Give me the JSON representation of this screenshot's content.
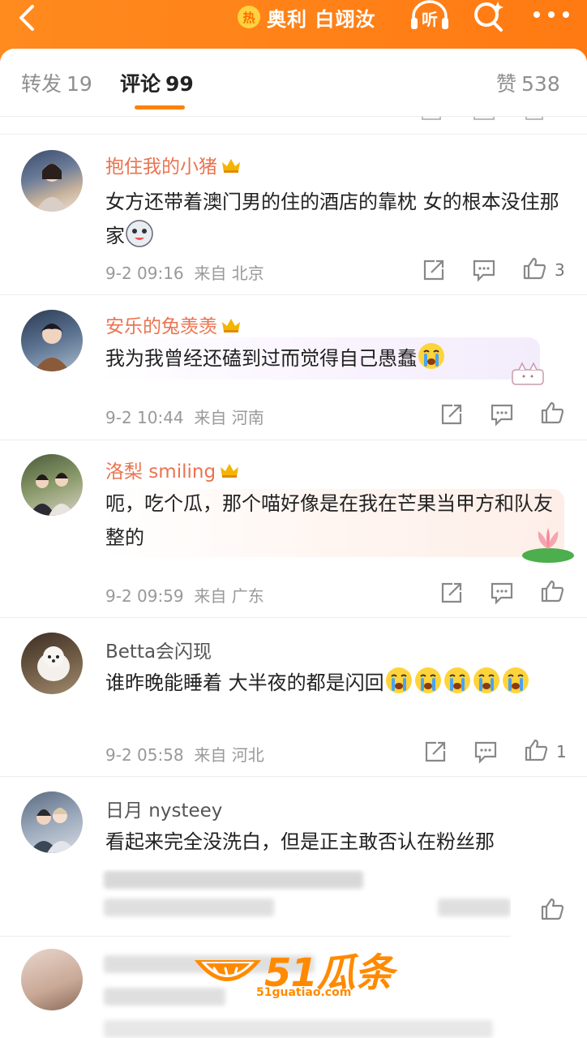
{
  "header": {
    "title": "奥利 白翊汝",
    "hot_badge": "热",
    "listen_label": "听",
    "back_icon": "chevron-left-icon",
    "search_icon": "search-sparkle-icon",
    "more_icon": "ellipsis-icon",
    "accent_color": "#ff8200"
  },
  "tabs": [
    {
      "label": "转发",
      "count": "19"
    },
    {
      "label": "评论",
      "count": "99",
      "active": true
    },
    {
      "label": "赞",
      "count": "538"
    }
  ],
  "comments": [
    {
      "username": "抱住我的小猪",
      "vip": true,
      "text": "女方还带着澳门男的住的酒店的靠枕 女的根本没住那家",
      "time": "9-2 09:16",
      "location": "来自 北京",
      "likes": "3"
    },
    {
      "username": "安乐的兔羡羡",
      "vip": true,
      "text": "我为我曾经还磕到过而觉得自己愚蠢",
      "time": "9-2 10:44",
      "location": "来自 河南",
      "likes": ""
    },
    {
      "username": "洛梨 smiling",
      "vip": true,
      "text": "呃，吃个瓜，那个喵好像是在我在芒果当甲方和队友整的",
      "time": "9-2 09:59",
      "location": "来自 广东",
      "likes": ""
    },
    {
      "username": "Betta会闪现",
      "vip": false,
      "text": "谁昨晚能睡着 大半夜的都是闪回",
      "time": "9-2 05:58",
      "location": "来自 河北",
      "likes": "1"
    },
    {
      "username": "日月 nysteey",
      "vip": false,
      "text": "看起来完全没洗白，但是正主敢否认在粉丝那",
      "time": "",
      "location": "",
      "likes": ""
    }
  ],
  "watermark": {
    "brand": "51瓜条",
    "url": "51guatiao.com"
  }
}
